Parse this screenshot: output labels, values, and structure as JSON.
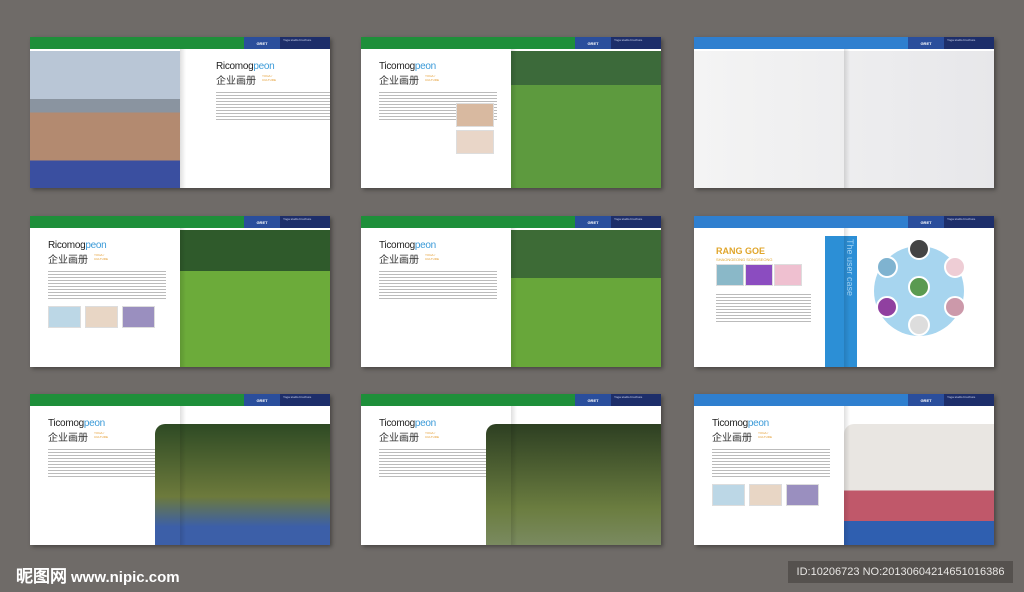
{
  "header": {
    "label": "GRET",
    "small_text": "Yoga studio brochure"
  },
  "spreads": [
    {
      "theme": "green",
      "title_a": "Ricomog",
      "title_b": "peon",
      "cn": "企业画册",
      "sub": "YOGA / CULTURE",
      "layout": "photo-left"
    },
    {
      "theme": "green",
      "title_a": "Ticomog",
      "title_b": "peon",
      "cn": "企业画册",
      "sub": "YOGA / CULTURE",
      "layout": "text-left-thumbs"
    },
    {
      "theme": "blue",
      "layout": "full-photo"
    },
    {
      "theme": "green",
      "title_a": "Ricomog",
      "title_b": "peon",
      "cn": "企业画册",
      "sub": "YOGA / CULTURE",
      "layout": "text-left-row"
    },
    {
      "theme": "green",
      "title_a": "Ticomog",
      "title_b": "peon",
      "cn": "企业画册",
      "sub": "YOGA / CULTURE",
      "layout": "text-left"
    },
    {
      "theme": "blue",
      "rang": "RANG GOE",
      "rang_sub": "SHAONGEONG SONGSEONG",
      "banner": "The user case",
      "layout": "user-case"
    },
    {
      "theme": "green",
      "title_a": "Ticomog",
      "title_b": "peon",
      "cn": "企业画册",
      "sub": "YOGA / CULTURE",
      "layout": "text-left-big"
    },
    {
      "theme": "green",
      "title_a": "Ticomog",
      "title_b": "peon",
      "cn": "企业画册",
      "sub": "YOGA / CULTURE",
      "layout": "text-left-big"
    },
    {
      "theme": "blue",
      "title_a": "Ticomog",
      "title_b": "peon",
      "cn": "企业画册",
      "sub": "YOGA / CULTURE",
      "layout": "text-left-row"
    }
  ],
  "watermark": {
    "logo": "昵图网",
    "url": "www.nipic.com"
  },
  "image_id": "ID:10206723 NO:20130604214651016386",
  "colors": {
    "green": "#1e8f3a",
    "blue": "#2f7fcf",
    "navy": "#1d2e6a",
    "bg": "#6f6b68"
  }
}
